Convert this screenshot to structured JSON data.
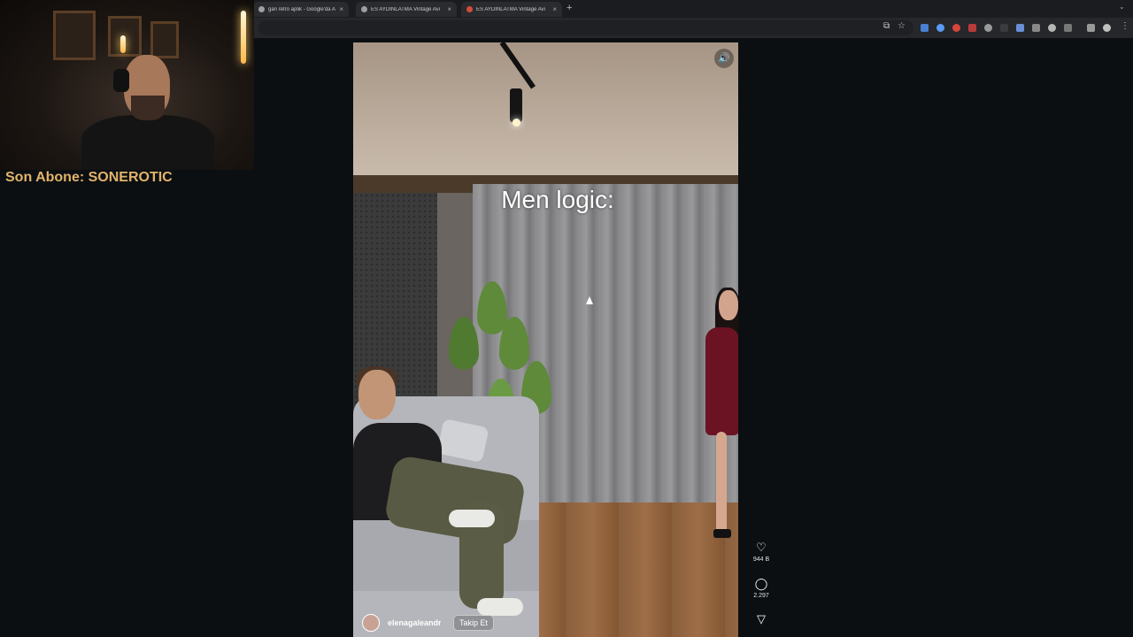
{
  "browser": {
    "tabs": [
      {
        "title": "gan retro aplik - Google'da A",
        "favicon": "google-icon"
      },
      {
        "title": "ES AYDINLATMA Vintage Avi",
        "favicon": "globe-icon"
      },
      {
        "title": "ES AYDINLATMA Vintage Avi",
        "favicon": "red-site-icon"
      }
    ],
    "new_tab_label": "+",
    "close_label": "×"
  },
  "stream": {
    "overlay_label": "Son Abone: SONEROTIC"
  },
  "reel": {
    "caption": "Men logic:",
    "username": "elenagaleandr",
    "follow_label": "Takip Et",
    "likes": "944 B",
    "comments": "2.297",
    "volume_icon": "speaker-icon"
  },
  "colors": {
    "page_bg": "#0c0f12",
    "stream_label": "#e2b36a"
  }
}
